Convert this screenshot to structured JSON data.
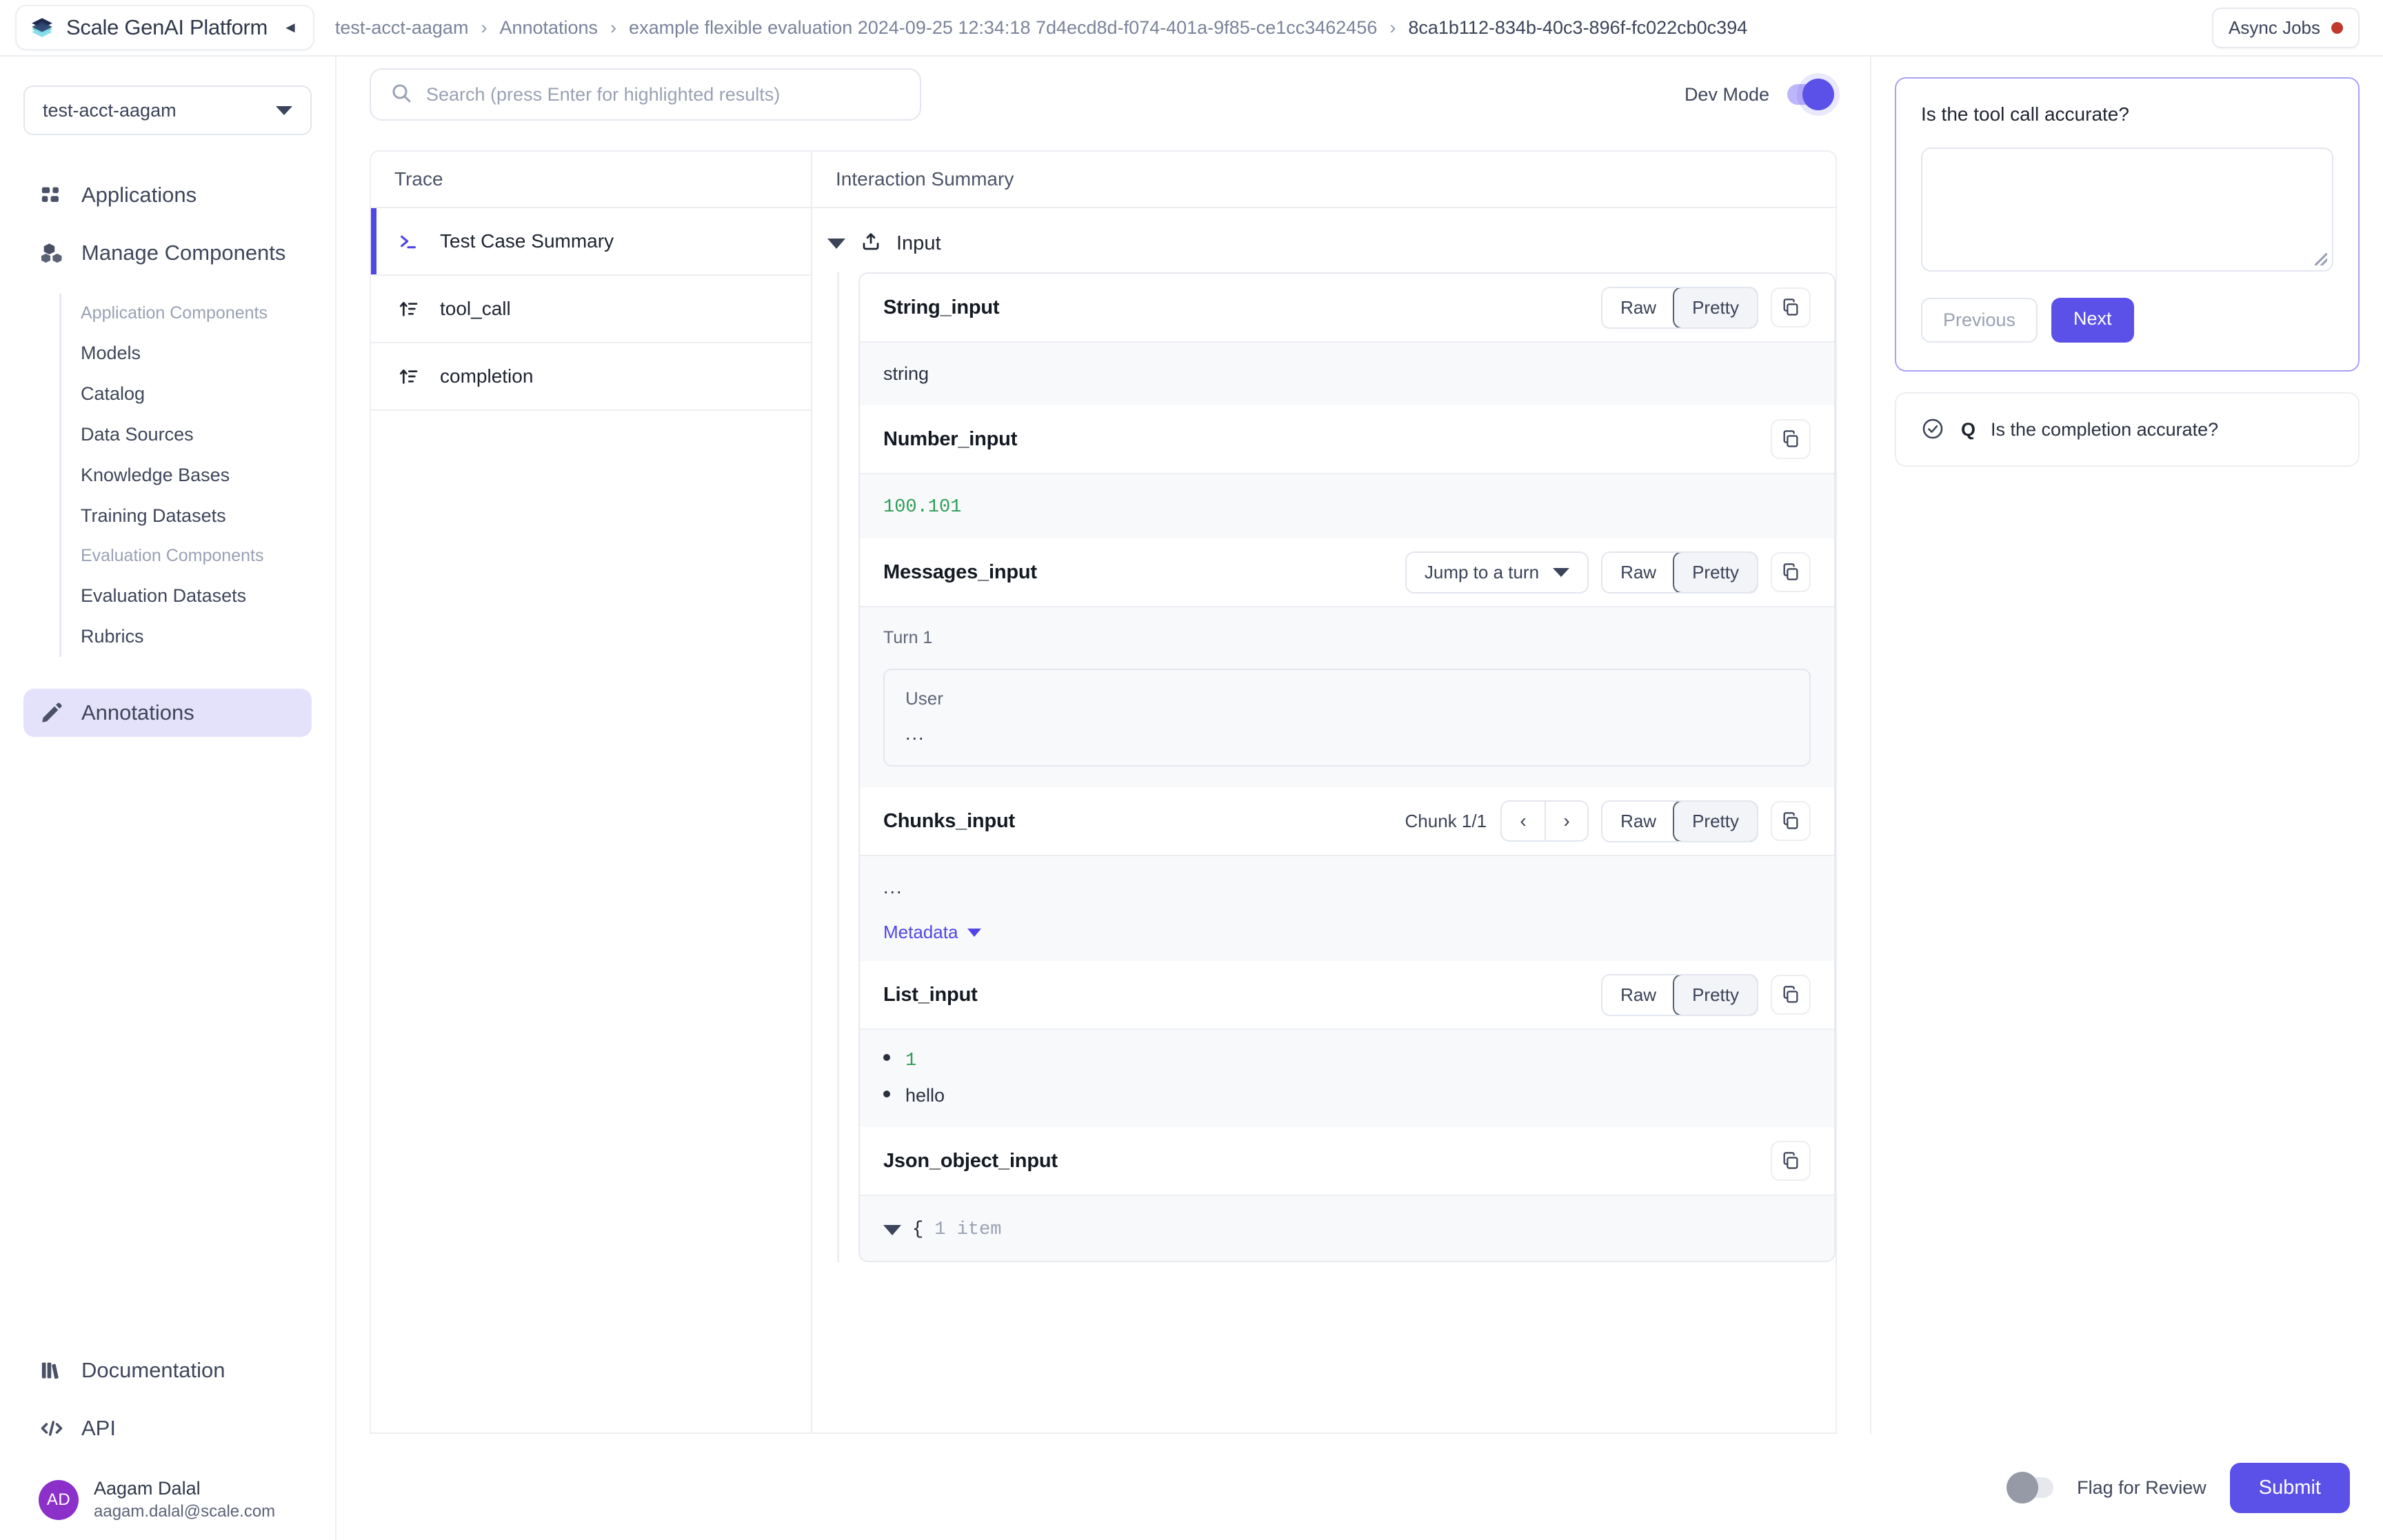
{
  "topbar": {
    "brand_name": "Scale GenAI Platform",
    "brand_logo_icon": "layers-icon",
    "collapse_icon": "collapse-left-icon",
    "breadcrumbs": [
      "test-acct-aagam",
      "Annotations",
      "example flexible evaluation 2024-09-25 12:34:18 7d4ecd8d-f074-401a-9f85-ce1cc3462456",
      "8ca1b112-834b-40c3-896f-fc022cb0c394"
    ],
    "breadcrumb_separator": "›",
    "async_jobs_label": "Async Jobs",
    "async_jobs_status_color": "#c0392b"
  },
  "sidebar": {
    "account_selector": {
      "value": "test-acct-aagam",
      "chevron_icon": "chevron-down-icon"
    },
    "nav": [
      {
        "label": "Applications",
        "icon": "grid-icon",
        "active": false
      },
      {
        "label": "Manage Components",
        "icon": "blocks-icon",
        "active": false
      }
    ],
    "subnav": [
      {
        "label": "Application Components",
        "type": "section"
      },
      {
        "label": "Models",
        "type": "item"
      },
      {
        "label": "Catalog",
        "type": "item"
      },
      {
        "label": "Data Sources",
        "type": "item"
      },
      {
        "label": "Knowledge Bases",
        "type": "item"
      },
      {
        "label": "Training Datasets",
        "type": "item"
      },
      {
        "label": "Evaluation Components",
        "type": "section"
      },
      {
        "label": "Evaluation Datasets",
        "type": "item"
      },
      {
        "label": "Rubrics",
        "type": "item"
      }
    ],
    "annotations": {
      "label": "Annotations",
      "icon": "pencil-icon",
      "active": true,
      "active_bg": "#e4e1fb"
    },
    "bottom_nav": [
      {
        "label": "Documentation",
        "icon": "books-icon"
      },
      {
        "label": "API",
        "icon": "code-icon"
      }
    ],
    "profile": {
      "initials": "AD",
      "name": "Aagam Dalal",
      "email": "aagam.dalal@scale.com",
      "avatar_color": "#8b30c9"
    }
  },
  "toolbar": {
    "search_placeholder": "Search (press Enter for highlighted results)",
    "search_icon": "search-icon",
    "search_value": "",
    "dev_mode_label": "Dev Mode",
    "dev_mode_on": true,
    "accent_color": "#5b51e8"
  },
  "trace_pane": {
    "header": "Trace",
    "rows": [
      {
        "label": "Test Case Summary",
        "icon": "terminal-icon",
        "active": true
      },
      {
        "label": "tool_call",
        "icon": "sort-icon",
        "active": false
      },
      {
        "label": "completion",
        "icon": "sort-icon",
        "active": false
      }
    ]
  },
  "summary_pane": {
    "header": "Interaction Summary",
    "group": {
      "label": "Input",
      "icon": "upload-icon",
      "expanded": true,
      "caret": "caret-down-icon"
    },
    "fields": [
      {
        "name": "String_input",
        "controls": {
          "segments": [
            "Raw",
            "Pretty"
          ],
          "selected": "Pretty",
          "copy_icon": "copy-icon"
        },
        "body_type": "text",
        "value": "string"
      },
      {
        "name": "Number_input",
        "controls": {
          "copy_icon": "copy-icon"
        },
        "body_type": "number",
        "value": "100.101"
      },
      {
        "name": "Messages_input",
        "controls": {
          "dropdown_label": "Jump to a turn",
          "dropdown_icon": "chevron-down-icon",
          "segments": [
            "Raw",
            "Pretty"
          ],
          "selected": "Pretty",
          "copy_icon": "copy-icon"
        },
        "body_type": "messages",
        "turn_label": "Turn 1",
        "messages": [
          {
            "role": "User",
            "text": "..."
          }
        ]
      },
      {
        "name": "Chunks_input",
        "controls": {
          "pager_text": "Chunk 1/1",
          "prev_icon": "chevron-left-icon",
          "next_icon": "chevron-right-icon",
          "segments": [
            "Raw",
            "Pretty"
          ],
          "selected": "Pretty",
          "copy_icon": "copy-icon"
        },
        "body_type": "chunk",
        "value": "...",
        "metadata_label": "Metadata",
        "metadata_icon": "caret-down-icon"
      },
      {
        "name": "List_input",
        "controls": {
          "segments": [
            "Raw",
            "Pretty"
          ],
          "selected": "Pretty",
          "copy_icon": "copy-icon"
        },
        "body_type": "list",
        "items": [
          {
            "value": "1",
            "kind": "number"
          },
          {
            "value": "hello",
            "kind": "text"
          }
        ]
      },
      {
        "name": "Json_object_input",
        "controls": {
          "copy_icon": "copy-icon"
        },
        "body_type": "json",
        "json_open": "{",
        "json_count": "1 item"
      }
    ]
  },
  "right_panel": {
    "active_question": {
      "title": "Is the tool call accurate?",
      "answer_value": "",
      "previous_label": "Previous",
      "next_label": "Next",
      "border_color": "#a9a2f5"
    },
    "other_questions": [
      {
        "letter": "Q",
        "label": "Is the completion accurate?",
        "check_icon": "check-circle-icon"
      }
    ]
  },
  "bottom_bar": {
    "flag_label": "Flag for Review",
    "flag_on": false,
    "submit_label": "Submit",
    "submit_color": "#5b51e8"
  }
}
